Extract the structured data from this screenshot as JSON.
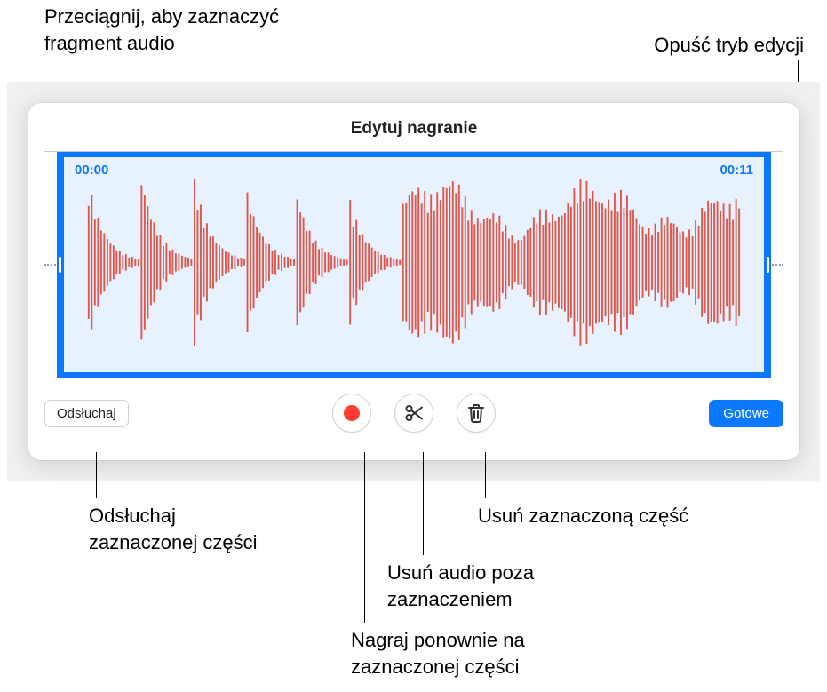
{
  "callouts": {
    "drag": "Przeciągnij, aby zaznaczyć\nfragment audio",
    "exit": "Opuść tryb edycji",
    "listen": "Odsłuchaj\nzaznaczonej części",
    "delete": "Usuń zaznaczoną część",
    "trim": "Usuń audio poza\nzaznaczeniem",
    "rerecord": "Nagraj ponownie na\nzaznaczonej części"
  },
  "panel": {
    "title": "Edytuj nagranie",
    "time_start": "00:00",
    "time_end": "00:11"
  },
  "toolbar": {
    "listen": "Odsłuchaj",
    "done": "Gotowe"
  },
  "icons": {
    "record": "record-icon",
    "scissors": "scissors-icon",
    "trash": "trash-icon"
  }
}
